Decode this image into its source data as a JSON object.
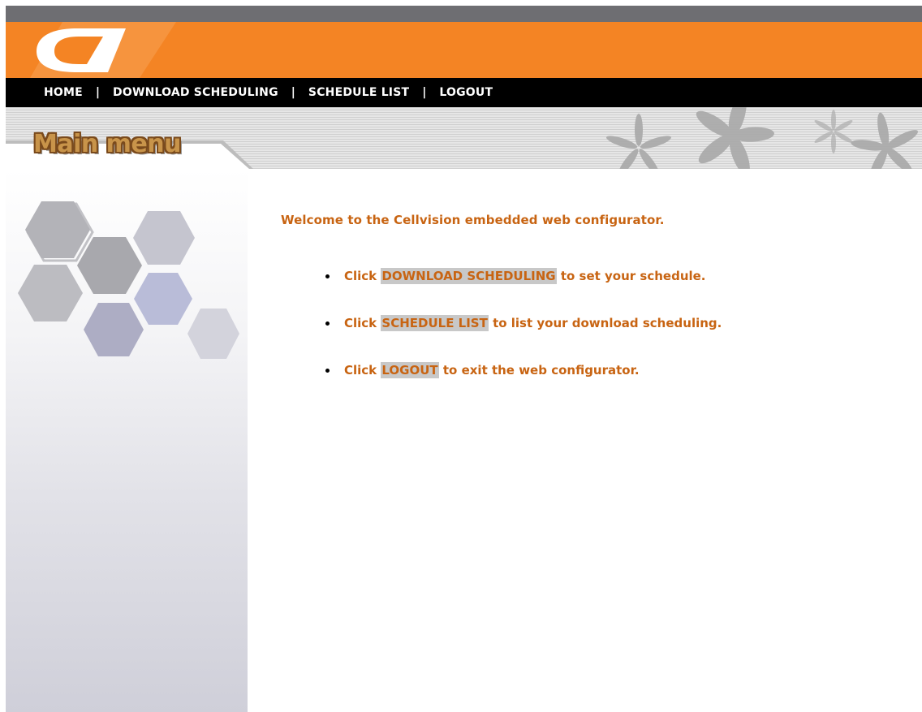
{
  "header": {
    "logo_icon": "cellvision-logo-icon",
    "colors": {
      "top_bar": "#6e6e72",
      "orange": "#f48424",
      "nav_bg": "#000000",
      "accent_text": "#c86412"
    }
  },
  "nav": {
    "items": [
      {
        "label": "HOME"
      },
      {
        "label": "DOWNLOAD SCHEDULING"
      },
      {
        "label": "SCHEDULE LIST"
      },
      {
        "label": "LOGOUT"
      }
    ],
    "separator": "|"
  },
  "page": {
    "title": "Main menu"
  },
  "main": {
    "welcome": "Welcome to the Cellvision embedded web configurator.",
    "instructions": [
      {
        "prefix": "Click ",
        "link": "DOWNLOAD SCHEDULING",
        "suffix": " to set your schedule."
      },
      {
        "prefix": "Click ",
        "link": "SCHEDULE LIST",
        "suffix": " to list your download scheduling."
      },
      {
        "prefix": "Click ",
        "link": "LOGOUT",
        "suffix": " to exit the web configurator."
      }
    ]
  }
}
